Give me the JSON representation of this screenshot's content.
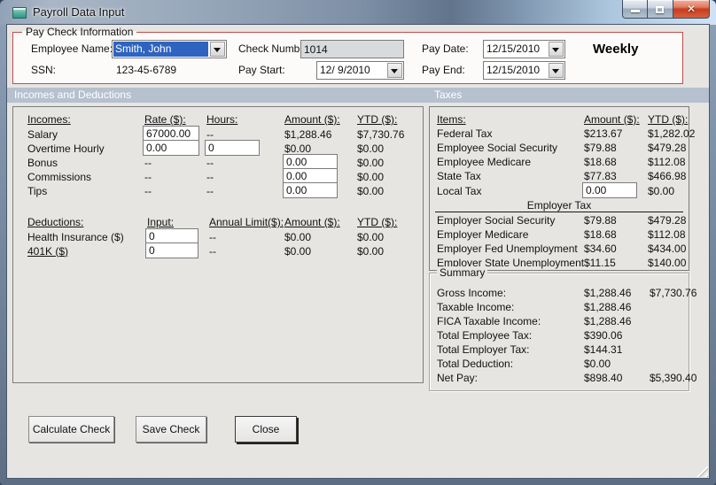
{
  "window": {
    "title": "Payroll Data Input",
    "icons": {
      "app_icon": "form-window",
      "minimize_icon": "horizontal-bar",
      "maximize_icon": "square-outline",
      "close_icon": "✕",
      "dropdown_arrow_icon": "▼",
      "resize_grip_icon": "diagonal-lines"
    }
  },
  "colors": {
    "group_border_red": "#bf4d4d",
    "section_band": "#b6c1cf",
    "selection_blue": "#2e64c0",
    "client_bg": "#e7e5e2",
    "close_button_red": "#c53d22"
  },
  "paycheck": {
    "legend": "Pay Check Information",
    "employee_name_label": "Employee Name:",
    "employee_name_value": "Smith, John",
    "ssn_label": "SSN:",
    "ssn_value": "123-45-6789",
    "check_number_label": "Check Number:",
    "check_number_value": "1014",
    "pay_start_label": "Pay Start:",
    "pay_start_value": "12/ 9/2010",
    "pay_date_label": "Pay Date:",
    "pay_date_value": "12/15/2010",
    "pay_end_label": "Pay End:",
    "pay_end_value": "12/15/2010",
    "frequency": "Weekly"
  },
  "sections": {
    "left": "Incomes and Deductions",
    "right": "Taxes"
  },
  "incomes": {
    "headers": {
      "item": "Incomes:",
      "rate": "Rate ($):",
      "hours": "Hours:",
      "amount": "Amount ($):",
      "ytd": "YTD ($):"
    },
    "rows": [
      {
        "label": "Salary",
        "rate": "67000.00",
        "hours": "--",
        "amount": "$1,288.46",
        "ytd": "$7,730.76"
      },
      {
        "label": "Overtime Hourly",
        "rate": "0.00",
        "hours": "0",
        "amount": "$0.00",
        "ytd": "$0.00"
      },
      {
        "label": "Bonus",
        "rate": "--",
        "hours": "--",
        "amount": "0.00",
        "ytd": "$0.00"
      },
      {
        "label": "Commissions",
        "rate": "--",
        "hours": "--",
        "amount": "0.00",
        "ytd": "$0.00"
      },
      {
        "label": "Tips",
        "rate": "--",
        "hours": "--",
        "amount": "0.00",
        "ytd": "$0.00"
      }
    ]
  },
  "deductions": {
    "headers": {
      "item": "Deductions:",
      "input": "Input:",
      "limit": "Annual Limit($):",
      "amount": "Amount ($):",
      "ytd": "YTD ($):"
    },
    "rows": [
      {
        "label": "Health Insurance  ($)",
        "input": "0",
        "limit": "--",
        "amount": "$0.00",
        "ytd": "$0.00"
      },
      {
        "label": "401K  ($)",
        "input": "0",
        "limit": "--",
        "amount": "$0.00",
        "ytd": "$0.00"
      }
    ]
  },
  "taxes": {
    "headers": {
      "item": "Items:",
      "amount": "Amount ($):",
      "ytd": "YTD ($):"
    },
    "employee_rows": [
      {
        "label": "Federal Tax",
        "amount": "$213.67",
        "ytd": "$1,282.02"
      },
      {
        "label": "Employee Social Security",
        "amount": "$79.88",
        "ytd": "$479.28"
      },
      {
        "label": "Employee Medicare",
        "amount": "$18.68",
        "ytd": "$112.08"
      },
      {
        "label": "State Tax",
        "amount": "$77.83",
        "ytd": "$466.98"
      },
      {
        "label": "Local Tax",
        "amount": "0.00",
        "ytd": "$0.00"
      }
    ],
    "employer_title": "Employer Tax",
    "employer_rows": [
      {
        "label": "Employer Social Security",
        "amount": "$79.88",
        "ytd": "$479.28"
      },
      {
        "label": "Employer Medicare",
        "amount": "$18.68",
        "ytd": "$112.08"
      },
      {
        "label": "Employer Fed Unemployment",
        "amount": "$34.60",
        "ytd": "$434.00"
      },
      {
        "label": "Employer State Unemployment",
        "amount": "$11.15",
        "ytd": "$140.00"
      }
    ]
  },
  "summary": {
    "legend": "Summary",
    "rows": [
      {
        "label": "Gross Income:",
        "amount": "$1,288.46",
        "ytd": "$7,730.76"
      },
      {
        "label": "Taxable Income:",
        "amount": "$1,288.46",
        "ytd": ""
      },
      {
        "label": "FICA Taxable Income:",
        "amount": "$1,288.46",
        "ytd": ""
      },
      {
        "label": "Total Employee Tax:",
        "amount": "$390.06",
        "ytd": ""
      },
      {
        "label": "Total Employer Tax:",
        "amount": "$144.31",
        "ytd": ""
      },
      {
        "label": "Total Deduction:",
        "amount": "$0.00",
        "ytd": ""
      },
      {
        "label": "Net Pay:",
        "amount": "$898.40",
        "ytd": "$5,390.40"
      }
    ]
  },
  "buttons": {
    "calculate": "Calculate Check",
    "save": "Save Check",
    "close": "Close"
  }
}
